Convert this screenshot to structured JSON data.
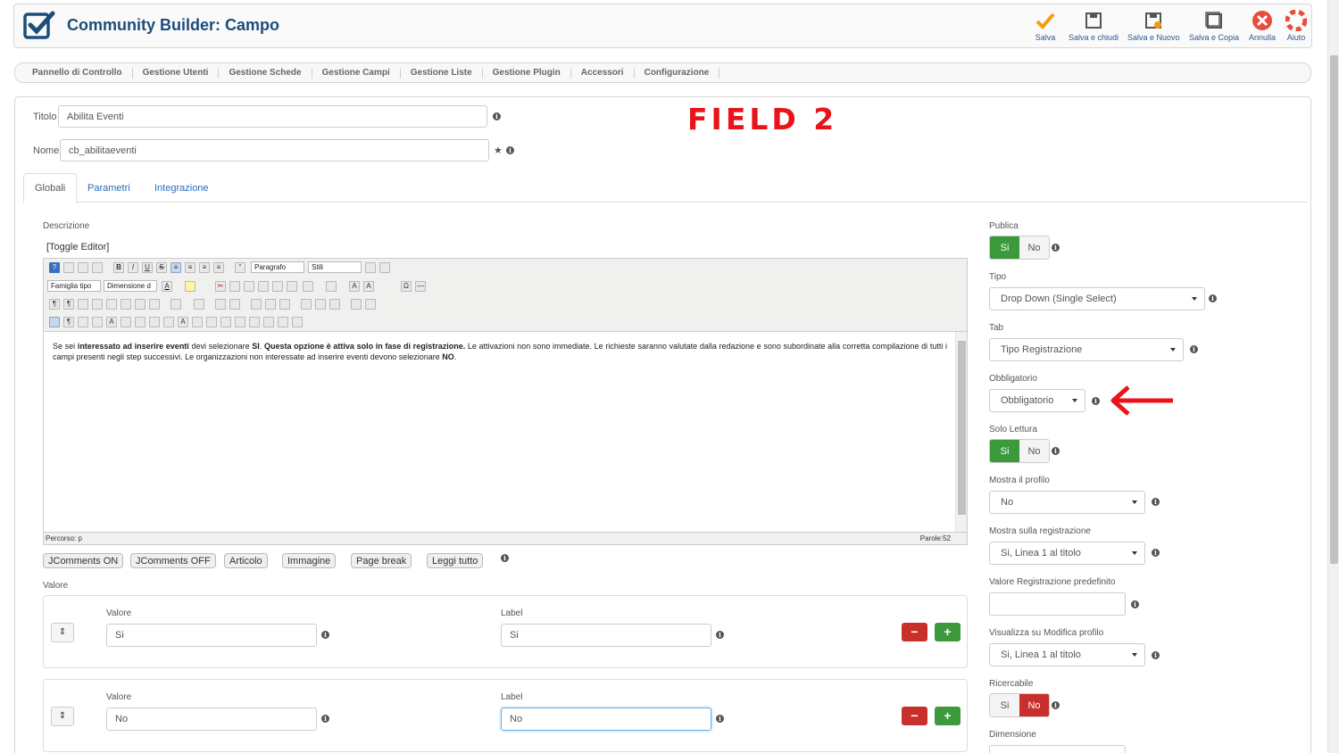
{
  "header": {
    "title": "Community Builder: Campo",
    "toolbar": [
      {
        "label": "Salva",
        "icon": "check-icon"
      },
      {
        "label": "Salva e chiudi",
        "icon": "save-icon"
      },
      {
        "label": "Salva e Nuovo",
        "icon": "save-new-icon"
      },
      {
        "label": "Salva e Copia",
        "icon": "save-copy-icon"
      },
      {
        "label": "Annulla",
        "icon": "cancel-icon"
      },
      {
        "label": "Aiuto",
        "icon": "help-icon"
      }
    ]
  },
  "nav": [
    "Pannello di Controllo",
    "Gestione Utenti",
    "Gestione Schede",
    "Gestione Campi",
    "Gestione Liste",
    "Gestione Plugin",
    "Accessori",
    "Configurazione"
  ],
  "annotation": "FIELD 2",
  "form": {
    "titolo_label": "Titolo",
    "titolo_value": "Abilita Eventi",
    "nome_label": "Nome",
    "nome_value": "cb_abilitaeventi"
  },
  "tabs": [
    "Globali",
    "Parametri",
    "Integrazione"
  ],
  "descrizione": {
    "label": "Descrizione",
    "toggle": "[Toggle Editor]",
    "format_select": "Paragrafo",
    "styles_select": "Stili",
    "font_select": "Famiglia tipo",
    "size_select": "Dimensione d",
    "content": {
      "p1": "Se sei ",
      "b1": "interessato ad inserire eventi",
      "p2": " devi selezionare ",
      "b2": "SI",
      "p3": ". ",
      "b3": "Questa opzione è attiva solo in fase di registrazione.",
      "p4": " Le attivazioni non sono immediate. Le richieste saranno valutate dalla redazione e sono subordinate alla corretta compilazione di tutti i campi presenti negli step successivi. Le organizzazioni non interessate ad inserire eventi devono selezionare ",
      "b4": "NO",
      "p5": "."
    },
    "path": "Percorso: p",
    "words": "Parole:52",
    "buttons": [
      "JComments ON",
      "JComments OFF",
      "Articolo",
      "Immagine",
      "Page break",
      "Leggi tutto"
    ]
  },
  "valore": {
    "label": "Valore",
    "rows": [
      {
        "valore_label": "Valore",
        "valore": "Si",
        "label_label": "Label",
        "label": "Si"
      },
      {
        "valore_label": "Valore",
        "valore": "No",
        "label_label": "Label",
        "label": "No"
      }
    ]
  },
  "right": {
    "publica_label": "Publica",
    "tipo_label": "Tipo",
    "tipo_value": "Drop Down (Single Select)",
    "tab_label": "Tab",
    "tab_value": "Tipo Registrazione",
    "obbligatorio_label": "Obbligatorio",
    "obbligatorio_value": "Obbligatorio",
    "solo_lettura_label": "Solo Lettura",
    "mostra_profilo_label": "Mostra il profilo",
    "mostra_profilo_value": "No",
    "mostra_reg_label": "Mostra sulla registrazione",
    "mostra_reg_value": "Si, Linea 1 al titolo",
    "valore_reg_label": "Valore Registrazione predefinito",
    "valore_reg_value": "",
    "visualizza_label": "Visualizza su Modifica profilo",
    "visualizza_value": "Si, Linea 1 al titolo",
    "ricercabile_label": "Ricercabile",
    "dimensione_label": "Dimensione",
    "si": "Si",
    "no": "No"
  },
  "colors": {
    "accent": "#1c4d7a",
    "green": "#3b9a3b",
    "red": "#c9302c",
    "annotation": "#e8141a"
  }
}
